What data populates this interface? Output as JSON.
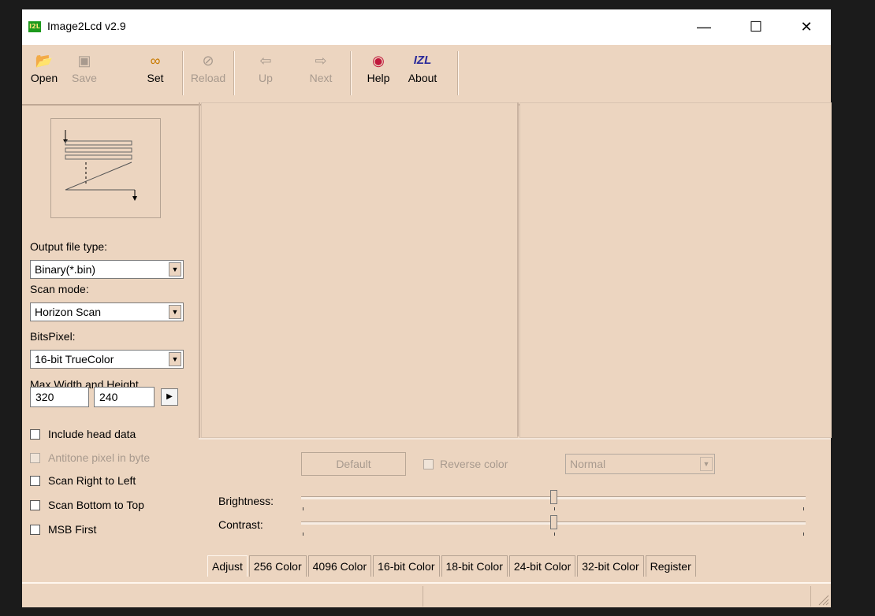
{
  "window": {
    "title": "Image2Lcd v2.9",
    "icon_text": "I2L"
  },
  "toolbar": {
    "buttons": [
      {
        "label": "Open",
        "icon": "open-icon",
        "enabled": true
      },
      {
        "label": "Save",
        "icon": "save-icon",
        "enabled": false
      },
      {
        "label": "Set",
        "icon": "set-icon",
        "enabled": true
      },
      {
        "label": "Reload",
        "icon": "reload-icon",
        "enabled": false
      },
      {
        "label": "Up",
        "icon": "up-icon",
        "enabled": false
      },
      {
        "label": "Next",
        "icon": "next-icon",
        "enabled": false
      },
      {
        "label": "Help",
        "icon": "help-icon",
        "enabled": true
      },
      {
        "label": "About",
        "icon": "about-icon",
        "icon_text": "IZL",
        "enabled": true
      }
    ]
  },
  "settings": {
    "output_file_type_label": "Output file type:",
    "output_file_type_value": "Binary(*.bin)",
    "scan_mode_label": "Scan mode:",
    "scan_mode_value": "Horizon Scan",
    "bits_pixel_label": "BitsPixel:",
    "bits_pixel_value": "16-bit TrueColor",
    "max_size_label": "Max Width and Height",
    "max_width": "320",
    "max_height": "240",
    "checkboxes": [
      {
        "label": "Include head data",
        "checked": false,
        "enabled": true
      },
      {
        "label": "Antitone pixel in byte",
        "checked": false,
        "enabled": false
      },
      {
        "label": "Scan Right to Left",
        "checked": false,
        "enabled": true
      },
      {
        "label": "Scan Bottom to Top",
        "checked": false,
        "enabled": true
      },
      {
        "label": "MSB First",
        "checked": false,
        "enabled": true
      }
    ]
  },
  "adjust": {
    "default_button": "Default",
    "reverse_color_label": "Reverse color",
    "mode_value": "Normal",
    "brightness_label": "Brightness:",
    "contrast_label": "Contrast:",
    "brightness_level": 0.5,
    "contrast_level": 0.5
  },
  "tabs": [
    "Adjust",
    "256 Color",
    "4096 Color",
    "16-bit Color",
    "18-bit Color",
    "24-bit Color",
    "32-bit Color",
    "Register"
  ],
  "colors": {
    "window_bg": "#ecd5c0",
    "desktop_bg": "#1b1b1b"
  }
}
